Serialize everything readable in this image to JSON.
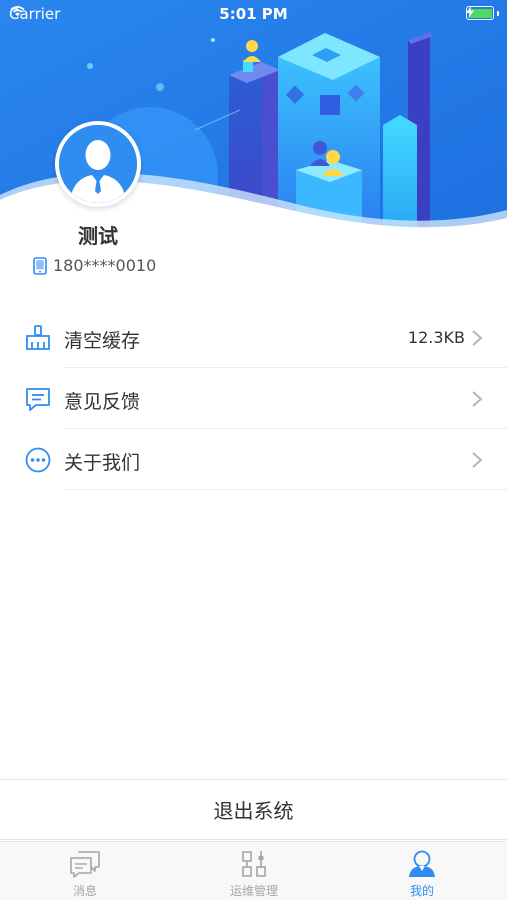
{
  "status_bar": {
    "carrier": "Carrier",
    "time": "5:01 PM"
  },
  "profile": {
    "name": "测试",
    "phone": "180****0010"
  },
  "menu": {
    "items": [
      {
        "label": "清空缓存",
        "value": "12.3KB",
        "icon": "broom-icon"
      },
      {
        "label": "意见反馈",
        "value": "",
        "icon": "feedback-icon"
      },
      {
        "label": "关于我们",
        "value": "",
        "icon": "more-icon"
      }
    ]
  },
  "logout": {
    "label": "退出系统"
  },
  "tabbar": {
    "tabs": [
      {
        "label": "消息",
        "icon": "message-icon",
        "active": false
      },
      {
        "label": "运维管理",
        "icon": "operations-icon",
        "active": false
      },
      {
        "label": "我的",
        "icon": "profile-icon",
        "active": true
      }
    ]
  },
  "colors": {
    "accent": "#2f8df2",
    "header_blue": "#2a86ee",
    "inactive_tab": "#a6a6a6"
  }
}
